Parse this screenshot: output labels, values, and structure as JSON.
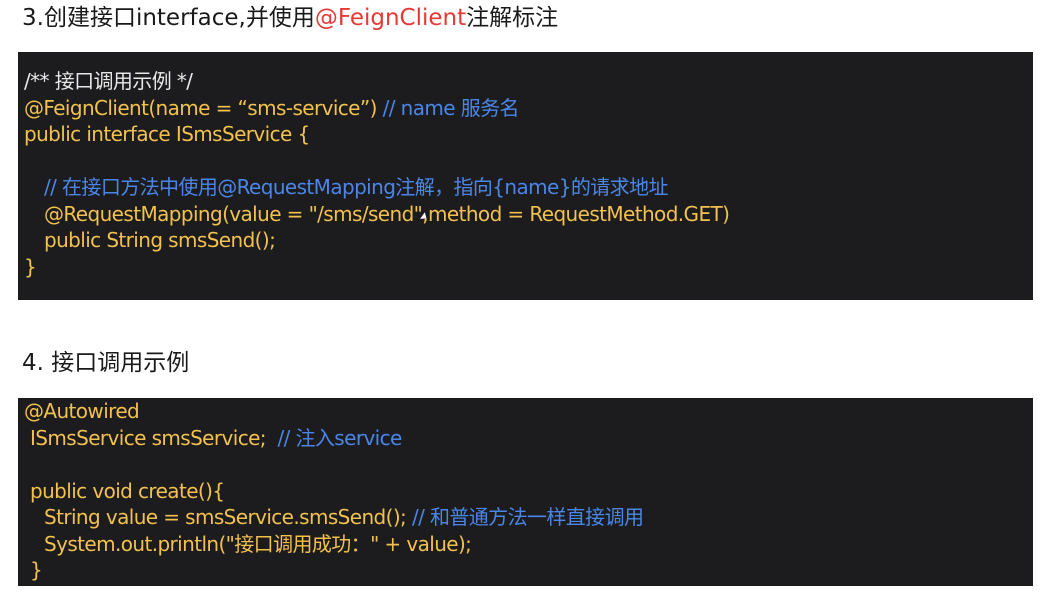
{
  "section3": {
    "heading_prefix": "3.创建接口interface,并使用",
    "heading_accent": "@FeignClient",
    "heading_suffix": "注解标注"
  },
  "code1": {
    "line1": "/** 接口调用示例 */",
    "line2_code": "@FeignClient(name = “sms-service”)",
    "line2_comment": " // name 服务名",
    "line3": "public interface ISmsService {",
    "line5_comment": "// 在接口方法中使用@RequestMapping注解，指向{name}的请求地址",
    "line6_a": "@RequestMapping(value = \"/sms/send\",",
    "line6_b": "method = RequestMethod.GET)",
    "line7": "public String smsSend();",
    "line8": "}"
  },
  "section4": {
    "heading": "4. 接口调用示例"
  },
  "code2": {
    "line1": "@Autowired",
    "line2_code": "ISmsService smsService;",
    "line2_comment": "  // 注入service",
    "line4": "public void create(){",
    "line5_code": "String value = smsService.smsSend();",
    "line5_comment": " // 和普通方法一样直接调用",
    "line6": "System.out.println(\"接口调用成功：\" + value);",
    "line7": "}"
  },
  "colors": {
    "code_background": "#1c1c1e",
    "code_text": "#f2c14e",
    "comment_text": "#4a86e8",
    "accent_red": "#e53935"
  }
}
